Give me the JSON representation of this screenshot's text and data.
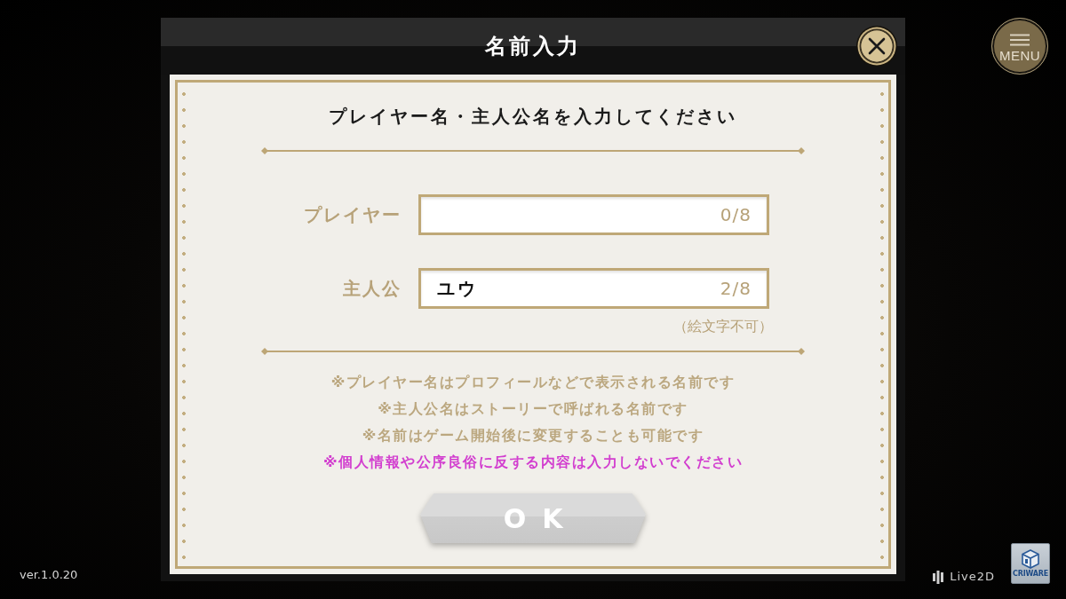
{
  "menu_button": {
    "label": "MENU"
  },
  "dialog": {
    "title": "名前入力",
    "heading": "プレイヤー名・主人公名を入力してください",
    "fields": [
      {
        "label": "プレイヤー",
        "counter": "0/8"
      },
      {
        "label": "主人公",
        "value": "ユウ",
        "counter": "2/8",
        "hint": "（絵文字不可）"
      }
    ],
    "notes": [
      {
        "kind": "info",
        "text": "※プレイヤー名はプロフィールなどで表示される名前です"
      },
      {
        "kind": "info",
        "text": "※主人公名はストーリーで呼ばれる名前です"
      },
      {
        "kind": "info",
        "text": "※名前はゲーム開始後に変更することも可能です"
      },
      {
        "kind": "warning",
        "text": "※個人情報や公序良俗に反する内容は入力しないでください"
      }
    ],
    "ok_button": {
      "label": "OK",
      "disabled": true
    }
  },
  "footer": {
    "version": "ver.1.0.20",
    "logos": [
      {
        "kind": "live2d",
        "label": "Live2D"
      },
      {
        "kind": "criware",
        "label": "CRIWARE"
      }
    ]
  }
}
